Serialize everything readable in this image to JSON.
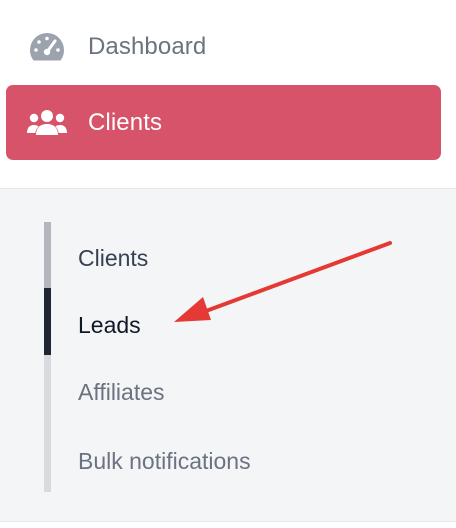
{
  "sidebar": {
    "items": [
      {
        "label": "Dashboard",
        "icon": "dashboard-gauge-icon",
        "active": false
      },
      {
        "label": "Clients",
        "icon": "users-group-icon",
        "active": true
      }
    ],
    "accent_color": "#d6536a"
  },
  "submenu": {
    "items": [
      {
        "label": "Clients",
        "state": "hover"
      },
      {
        "label": "Leads",
        "state": "active"
      },
      {
        "label": "Affiliates",
        "state": "default"
      },
      {
        "label": "Bulk notifications",
        "state": "default"
      }
    ],
    "active_indicator_color": "#1f2532"
  },
  "annotation": {
    "type": "red-arrow",
    "color": "#e53935",
    "points_to": "Leads"
  }
}
